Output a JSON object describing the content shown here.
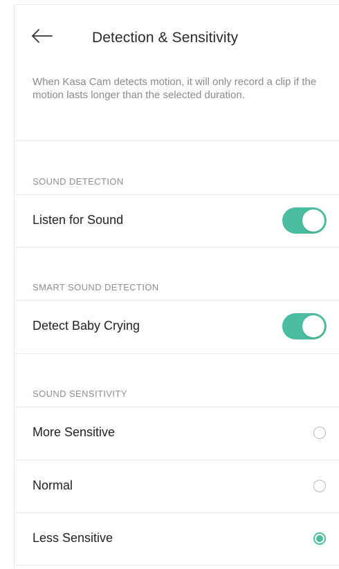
{
  "header": {
    "back_icon": "arrow-left-icon",
    "title": "Detection & Sensitivity"
  },
  "intro": "When Kasa Cam detects motion, it will only record a clip if the motion lasts longer than the selected duration.",
  "sound_detection": {
    "section_label": "SOUND DETECTION",
    "listen_label": "Listen for Sound",
    "listen_enabled": true
  },
  "smart_sound": {
    "section_label": "SMART SOUND DETECTION",
    "baby_label": "Detect Baby Crying",
    "baby_enabled": true
  },
  "sensitivity": {
    "section_label": "SOUND SENSITIVITY",
    "options": [
      {
        "label": "More Sensitive",
        "selected": false
      },
      {
        "label": "Normal",
        "selected": false
      },
      {
        "label": "Less Sensitive",
        "selected": true
      }
    ]
  },
  "colors": {
    "accent": "#4bbd9f",
    "muted_text": "#8a8a8a",
    "separator": "#ececec"
  }
}
